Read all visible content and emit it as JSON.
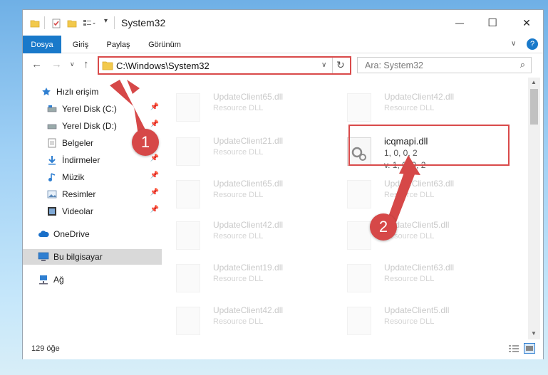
{
  "window": {
    "title": "System32"
  },
  "window_controls": {
    "minimize": "—",
    "maximize": "☐",
    "close": "✕"
  },
  "ribbon": {
    "tabs": [
      "Dosya",
      "Giriş",
      "Paylaş",
      "Görünüm"
    ]
  },
  "address": {
    "path": "C:\\Windows\\System32"
  },
  "search": {
    "placeholder": "Ara: System32"
  },
  "sidebar": {
    "items": [
      {
        "label": "Hızlı erişim"
      },
      {
        "label": "Yerel Disk (C:)"
      },
      {
        "label": "Yerel Disk (D:)"
      },
      {
        "label": "Belgeler"
      },
      {
        "label": "İndirmeler"
      },
      {
        "label": "Müzik"
      },
      {
        "label": "Resimler"
      },
      {
        "label": "Videolar"
      },
      {
        "label": "OneDrive"
      },
      {
        "label": "Bu bilgisayar"
      },
      {
        "label": "Ağ"
      }
    ]
  },
  "files": [
    {
      "name": "UpdateClient65.dll",
      "sub": "Resource DLL"
    },
    {
      "name": "UpdateClient42.dll",
      "sub": "Resource DLL"
    },
    {
      "name": "UpdateClient21.dll",
      "sub": "Resource DLL"
    },
    {
      "name": "icqmapi.dll",
      "sub": "1, 0, 0, 2",
      "sub2": "v. 1, 0, 0, 2"
    },
    {
      "name": "UpdateClient65.dll",
      "sub": "Resource DLL"
    },
    {
      "name": "UpdateClient63.dll",
      "sub": "Resource DLL"
    },
    {
      "name": "UpdateClient42.dll",
      "sub": "Resource DLL"
    },
    {
      "name": "UpdateClient5.dll",
      "sub": "Resource DLL"
    },
    {
      "name": "UpdateClient19.dll",
      "sub": "Resource DLL"
    },
    {
      "name": "UpdateClient63.dll",
      "sub": "Resource DLL"
    },
    {
      "name": "UpdateClient42.dll",
      "sub": "Resource DLL"
    },
    {
      "name": "UpdateClient5.dll",
      "sub": "Resource DLL"
    }
  ],
  "status": {
    "count": "129 öğe"
  },
  "annotations": {
    "step1": "1",
    "step2": "2"
  },
  "colors": {
    "accent": "#1979ca",
    "highlight": "#d94a4a",
    "arrow": "#d64848"
  }
}
